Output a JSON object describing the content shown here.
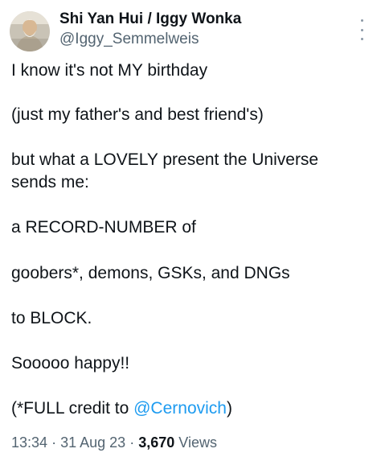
{
  "author": {
    "name": "Shi Yan Hui / Iggy Wonka",
    "handle": "@Iggy_Semmelweis"
  },
  "tweet": {
    "line1": "I know it's not MY birthday",
    "line2": "(just my father's and best friend's)",
    "line3": "but what a LOVELY present the Universe",
    "line4": "sends me:",
    "line5": "a RECORD-NUMBER of",
    "line6": "goobers*, demons, GSKs, and DNGs",
    "line7": "to BLOCK.",
    "line8": "Sooooo happy!!",
    "line9_prefix": "(*FULL credit to ",
    "mention": "@Cernovich",
    "line9_suffix": ")"
  },
  "meta": {
    "time": "13:34",
    "date": "31 Aug 23",
    "views_count": "3,670",
    "views_label": "Views"
  },
  "icons": {
    "more": "more-options-icon",
    "avatar": "profile-photo"
  }
}
